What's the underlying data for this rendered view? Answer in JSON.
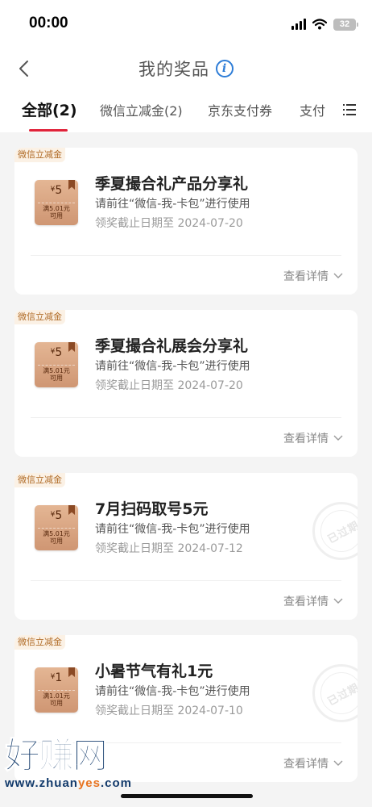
{
  "status_bar": {
    "time": "00:00",
    "battery": "32"
  },
  "header": {
    "title": "我的奖品"
  },
  "tabs": [
    {
      "label": "全部(2)"
    },
    {
      "label": "微信立减金(2)"
    },
    {
      "label": "京东支付券"
    },
    {
      "label": "支付"
    }
  ],
  "cards": [
    {
      "tag": "微信立减金",
      "coupon_amount": "5",
      "coupon_condition_1": "满5.01元",
      "coupon_condition_2": "可用",
      "title": "季夏撮合礼产品分享礼",
      "usage": "请前往“微信-我-卡包”进行使用",
      "deadline": "领奖截止日期至 2024-07-20",
      "details_label": "查看详情",
      "expired": false
    },
    {
      "tag": "微信立减金",
      "coupon_amount": "5",
      "coupon_condition_1": "满5.01元",
      "coupon_condition_2": "可用",
      "title": "季夏撮合礼展会分享礼",
      "usage": "请前往“微信-我-卡包”进行使用",
      "deadline": "领奖截止日期至 2024-07-20",
      "details_label": "查看详情",
      "expired": false
    },
    {
      "tag": "微信立减金",
      "coupon_amount": "5",
      "coupon_condition_1": "满5.01元",
      "coupon_condition_2": "可用",
      "title": "7月扫码取号5元",
      "usage": "请前往“微信-我-卡包”进行使用",
      "deadline": "领奖截止日期至 2024-07-12",
      "details_label": "查看详情",
      "expired": true,
      "stamp": "已过期"
    },
    {
      "tag": "微信立减金",
      "coupon_amount": "1",
      "coupon_condition_1": "满1.01元",
      "coupon_condition_2": "可用",
      "title": "小暑节气有礼1元",
      "usage": "请前往“微信-我-卡包”进行使用",
      "deadline": "领奖截止日期至 2024-07-10",
      "details_label": "查看详情",
      "expired": true,
      "stamp": "已过期"
    }
  ],
  "watermark": {
    "brand": "好赚网",
    "url_prefix": "www.zhuan",
    "url_highlight": "yes",
    "url_suffix": ".com"
  },
  "icons": {
    "back": "chevron-left-icon",
    "info": "info-icon",
    "menu": "list-menu-icon",
    "details": "chevron-down-icon"
  },
  "colors": {
    "accent": "#e0233a",
    "info_blue": "#2e7dd7",
    "coupon": "#d9a582",
    "tag_text": "#b06b26"
  }
}
